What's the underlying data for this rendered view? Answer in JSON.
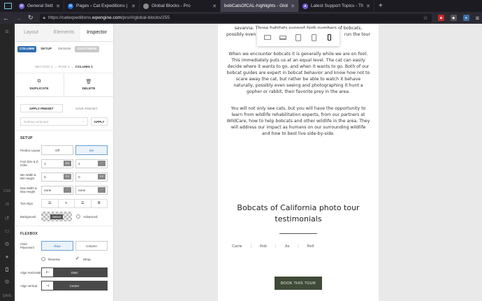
{
  "browser": {
    "tabs": [
      {
        "title": "General Settings ‹ Cat Expeditions",
        "active": false
      },
      {
        "title": "Pages ‹ Cat Expeditions | Ethical Fe",
        "active": false
      },
      {
        "title": "Global Blocks - Pro",
        "active": false
      },
      {
        "title": "bobCatsOfCAL-highlights - Global",
        "active": true
      },
      {
        "title": "Latest Support Topics - Themc",
        "active": false
      }
    ],
    "new_tab": "+",
    "url_prefix": "https://catexpeditions.",
    "url_domain": "wpengine.com",
    "url_path": "/pro/#/global-blocks/255"
  },
  "rail": {
    "css": "CSS",
    "js": "JS",
    "save": "SAVE"
  },
  "panel": {
    "tabs": [
      "Layout",
      "Elements",
      "Inspector"
    ],
    "subtabs": {
      "column": "COLUMN",
      "setup": "SETUP",
      "design": "DESIGN",
      "customize": "CUSTOMIZE"
    },
    "breadcrumb": {
      "path": "SECTION 2 → ROW 2 →",
      "current": "COLUMN 1"
    },
    "duplicate": "DUPLICATE",
    "delete": "DELETE",
    "apply_preset": "APPLY PRESET",
    "save_preset": "SAVE PRESET",
    "preset_placeholder": "Nothing Selected",
    "apply": "APPLY",
    "setup": {
      "heading": "SETUP",
      "flexbox_label": "Flexbox Layout",
      "off": "Off",
      "on": "On",
      "font_label": "Font Size & Z-Index",
      "font_value": "1",
      "font_unit": "EM",
      "z_value": "1",
      "min_label": "Min Width & Min Height",
      "min_w": "0",
      "min_w_unit": "PX",
      "min_h": "0",
      "min_h_unit": "PX",
      "max_label": "Max Width & Max Height",
      "max_w": "none",
      "max_h": "none",
      "align_label": "Text Align",
      "bg_label": "Background",
      "bg_select": "Select",
      "advanced": "Advanced"
    },
    "flexbox": {
      "heading": "FLEXBOX",
      "child_label": "Child Placement",
      "row": "Row",
      "column": "Column",
      "reverse": "Reverse",
      "wrap": "Wrap",
      "horiz_label": "Align Horizontal",
      "horiz_value": "Start",
      "vert_label": "Align Vertical",
      "vert_value": "Center"
    }
  },
  "page": {
    "p1a": "savanna. Those habitats support high numbers of bobcats,",
    "p1b": "possibly even",
    "p1c": "run the tour",
    "p1d": "b",
    "p2": "When we encounter bobcats it is generally while we are on foot. This immediately puts us at an equal level. The cat can easily decide where it wants to go, and when it wants to go. Both of our bobcat guides are expert in bobcat behavior and know how not to scare away the cat, but rather be able to watch it behave naturally, possibly even seeing and photographing it hunt a gopher or rabbit, their favorite prey in the area.",
    "p3": "You will not only see cats, but you will have the opportunity to learn from wildlife rehabilitation experts, from our partners at WildCare, how to help bobcats and other wildlife in the area. They will address our impact as humans on our surrounding wildlife and how to best live side-by-side.",
    "title": "Bobcats of California photo tour testimonials",
    "names": [
      "Carrie",
      "Rob",
      "Jia",
      "Rell"
    ],
    "button": "BOOK THIS TOUR"
  }
}
